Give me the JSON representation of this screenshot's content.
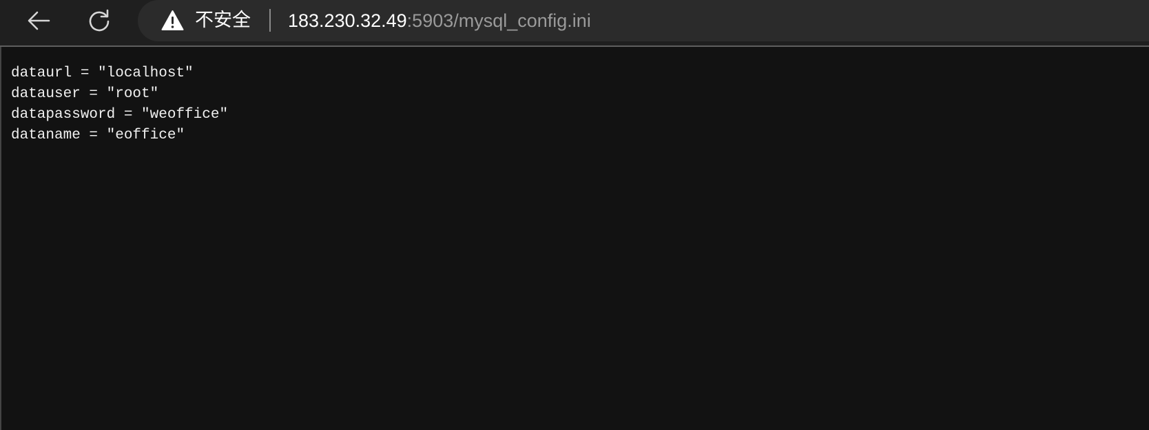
{
  "browser": {
    "security_label": "不安全",
    "url_host": "183.230.32.49",
    "url_rest": ":5903/mysql_config.ini",
    "icons": {
      "back": "back-arrow-icon",
      "reload": "reload-icon",
      "warning": "warning-icon"
    }
  },
  "file": {
    "lines": [
      "dataurl = ″localhost″",
      "datauser = ″root″",
      "datapassword = ″weoffice″",
      "dataname = ″eoffice″"
    ]
  },
  "colors": {
    "page_background": "#121212",
    "toolbar_background": "#1f1f1f",
    "omnibox_background": "#2b2b2b",
    "text": "#f0f0f0",
    "url_dim": "#9a9a9a"
  }
}
